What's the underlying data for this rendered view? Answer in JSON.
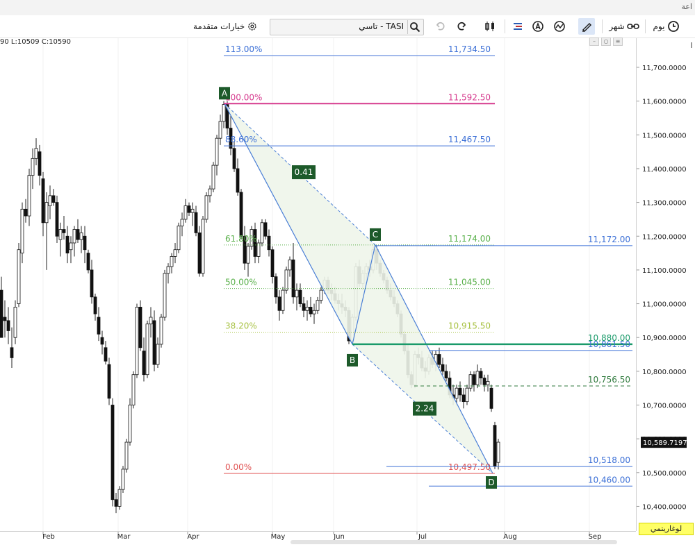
{
  "window": {
    "title_fragment": "اعة"
  },
  "toolbar": {
    "interval_day_label": "يوم",
    "interval_month_label": "شهر",
    "search_value": "TASI - تاسي",
    "advanced_options_label": "خيارات متقدمة"
  },
  "ohlc": {
    "text": "90  L:10509  C:10590"
  },
  "xaxis": {
    "labels": [
      {
        "text": "Feb",
        "pos": 70
      },
      {
        "text": "Mar",
        "pos": 178
      },
      {
        "text": "Apr",
        "pos": 278
      },
      {
        "text": "May",
        "pos": 400
      },
      {
        "text": "Jun",
        "pos": 488
      },
      {
        "text": "Jul",
        "pos": 608
      },
      {
        "text": "Aug",
        "pos": 734
      },
      {
        "text": "Sep",
        "pos": 856
      }
    ]
  },
  "yaxis": {
    "labels": [
      "11,700.0000",
      "11,600.0000",
      "11,500.0000",
      "11,400.0000",
      "11,300.0000",
      "11,200.0000",
      "11,100.0000",
      "11,000.0000",
      "10,900.0000",
      "10,800.0000",
      "10,700.0000",
      "10,600.0000",
      "10,500.0000",
      "10,400.0000"
    ],
    "values": [
      11700,
      11600,
      11500,
      11400,
      11300,
      11200,
      11100,
      11000,
      10900,
      10800,
      10700,
      10600,
      10500,
      10400
    ],
    "current_price": "10,589.7197"
  },
  "log_scale_label": "لوغاريتمي",
  "fib_levels": [
    {
      "pct": "113.00%",
      "price": "11,734.50",
      "value": 11734.5,
      "color": "#3b6fd6",
      "style": "solid"
    },
    {
      "pct": "100.00%",
      "price": "11,592.50",
      "value": 11592.5,
      "color": "#d63a8e",
      "style": "solid"
    },
    {
      "pct": "88.60%",
      "price": "11,467.50",
      "value": 11467.5,
      "color": "#3b6fd6",
      "style": "solid"
    },
    {
      "pct": "61.80%",
      "price": "11,174.00",
      "value": 11174,
      "color": "#59b04a",
      "style": "dotted"
    },
    {
      "pct": "50.00%",
      "price": "11,045.00",
      "value": 11045,
      "color": "#59b04a",
      "style": "dotted"
    },
    {
      "pct": "38.20%",
      "price": "10,915.50",
      "value": 10915.5,
      "color": "#a8c243",
      "style": "dotted"
    },
    {
      "pct": "0.00%",
      "price": "10,497.50",
      "value": 10497.5,
      "color": "#e05252",
      "style": "solid"
    }
  ],
  "right_levels": [
    {
      "price": "11,172.00",
      "value": 11172,
      "color": "#3b6fd6",
      "style": "solid"
    },
    {
      "price": "10,880.00",
      "value": 10880,
      "color": "#1a9a6a",
      "style": "thick"
    },
    {
      "price": "10,861.50",
      "value": 10861.5,
      "color": "#3b6fd6",
      "style": "solid"
    },
    {
      "price": "10,756.50",
      "value": 10756.5,
      "color": "#2f7a3d",
      "style": "dashed"
    },
    {
      "price": "10,518.00",
      "value": 10518,
      "color": "#3b6fd6",
      "style": "solid"
    },
    {
      "price": "10,460.00",
      "value": 10460,
      "color": "#3b6fd6",
      "style": "solid"
    }
  ],
  "pattern": {
    "points": [
      "A",
      "B",
      "C",
      "D"
    ],
    "ratios": [
      "0.41",
      "2.24"
    ]
  },
  "colors": {
    "accent": "#3b6fd6",
    "label_bg": "#1d5a2a",
    "fill": "#eef5ea"
  }
}
